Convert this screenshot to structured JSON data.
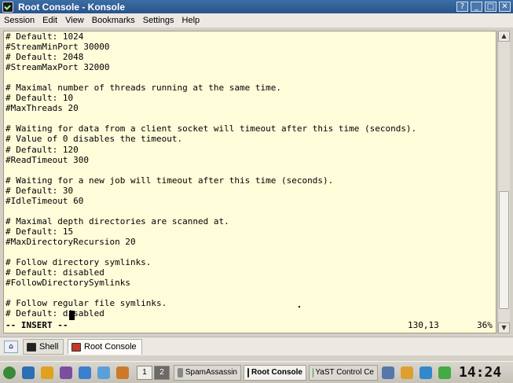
{
  "window": {
    "title": "Root Console - Konsole",
    "buttons": [
      "?",
      "_",
      "□",
      "✕"
    ]
  },
  "menu": [
    "Session",
    "Edit",
    "View",
    "Bookmarks",
    "Settings",
    "Help"
  ],
  "terminal": {
    "lines": [
      "# Default: 1024",
      "#StreamMinPort 30000",
      "# Default: 2048",
      "#StreamMaxPort 32000",
      "",
      "# Maximal number of threads running at the same time.",
      "# Default: 10",
      "#MaxThreads 20",
      "",
      "# Waiting for data from a client socket will timeout after this time (seconds).",
      "# Value of 0 disables the timeout.",
      "# Default: 120",
      "#ReadTimeout 300",
      "",
      "# Waiting for a new job will timeout after this time (seconds).",
      "# Default: 30",
      "#IdleTimeout 60",
      "",
      "# Maximal depth directories are scanned at.",
      "# Default: 15",
      "#MaxDirectoryRecursion 20",
      "",
      "# Follow directory symlinks.",
      "# Default: disabled",
      "#FollowDirectorySymlinks",
      "",
      "# Follow regular file symlinks.",
      "# Default: disabled"
    ],
    "status_mode": "-- INSERT --",
    "status_position": "130,13",
    "status_percent": "36%"
  },
  "tabs": [
    {
      "label": "Shell",
      "active": false
    },
    {
      "label": "Root Console",
      "active": true
    }
  ],
  "taskbar": {
    "desktops": [
      "1",
      "2"
    ],
    "active_desktop": "2",
    "tasks": [
      {
        "label": "SpamAssassin",
        "active": false
      },
      {
        "label": "Root Console",
        "active": true
      },
      {
        "label": "YaST Control Ce",
        "active": false
      }
    ],
    "clock": "14:24"
  },
  "colors": {
    "terminal_bg": "#fffcda",
    "titlebar": "#2f5c94"
  }
}
